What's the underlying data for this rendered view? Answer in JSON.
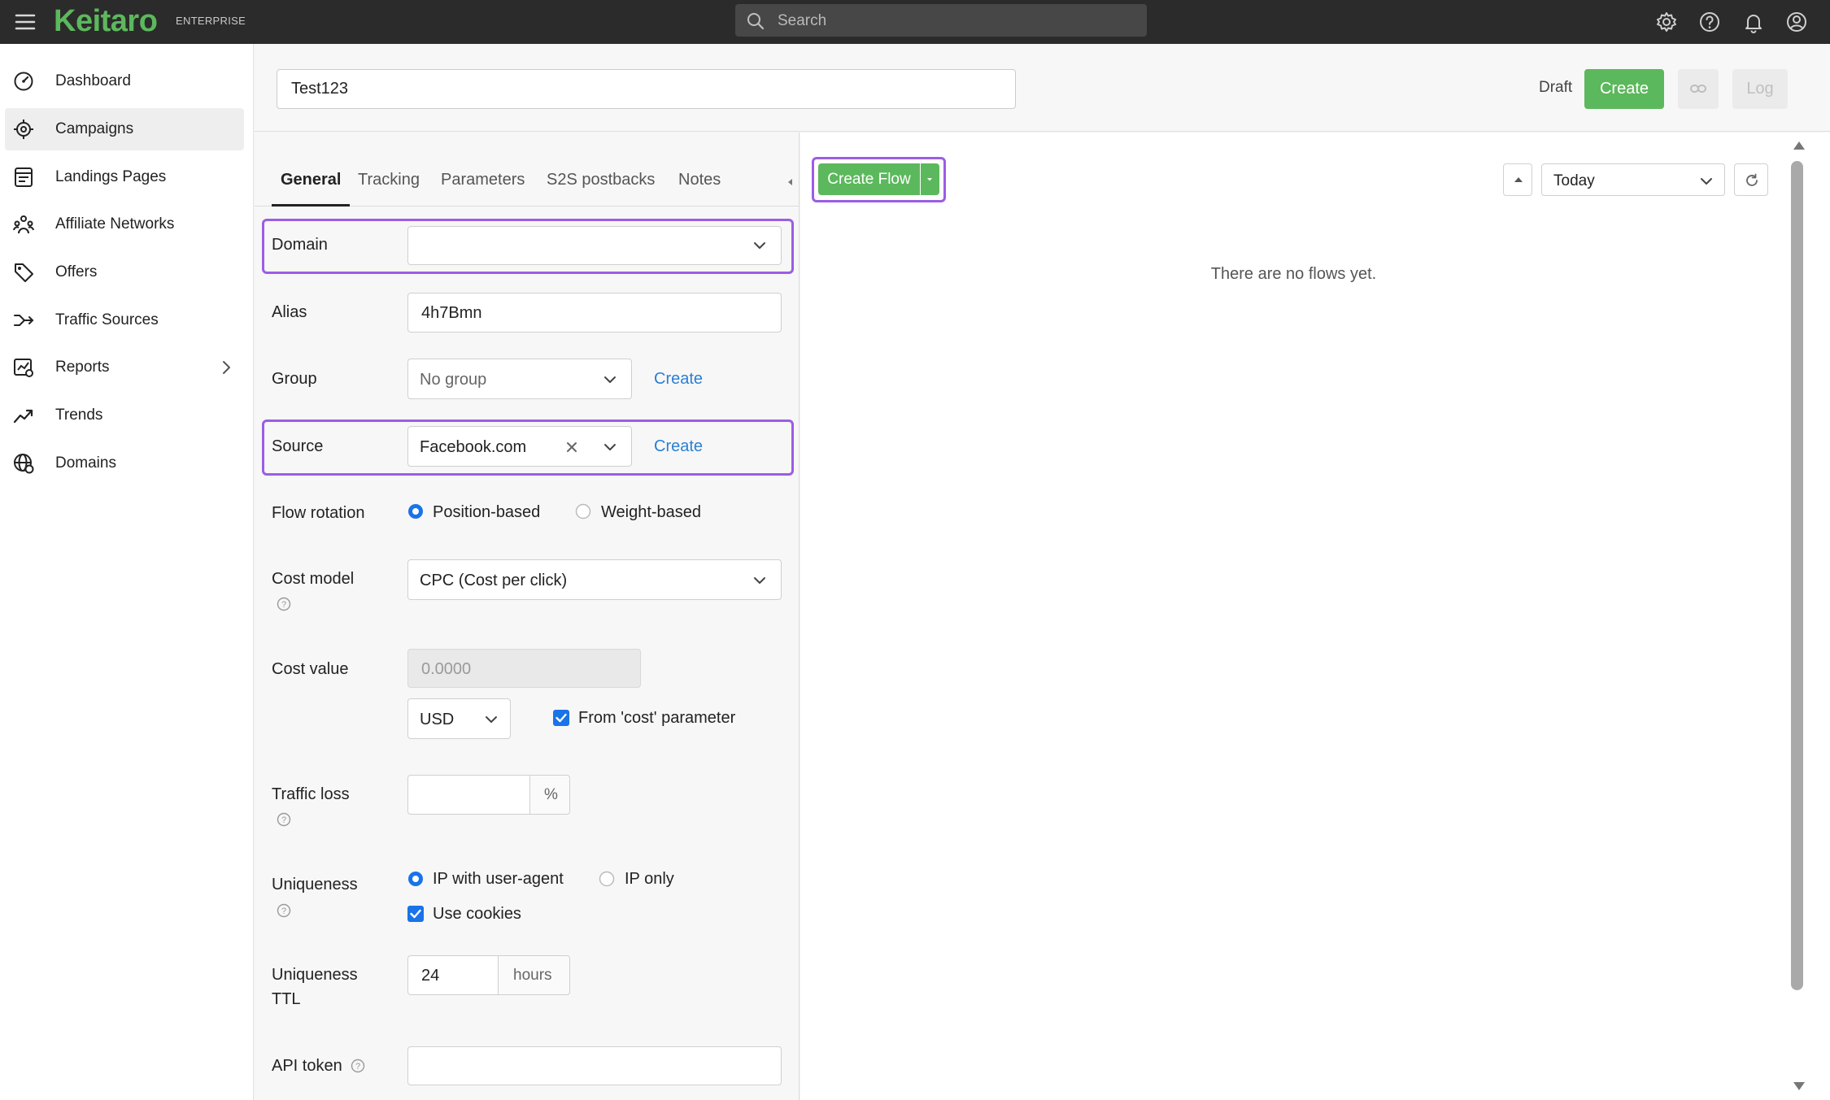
{
  "app": {
    "logo": "Keitaro",
    "edition": "ENTERPRISE",
    "search_placeholder": "Search"
  },
  "sidebar": {
    "items": [
      {
        "label": "Dashboard",
        "icon": "gauge-icon"
      },
      {
        "label": "Campaigns",
        "icon": "target-icon",
        "active": true
      },
      {
        "label": "Landings Pages",
        "icon": "page-icon"
      },
      {
        "label": "Affiliate Networks",
        "icon": "users-icon"
      },
      {
        "label": "Offers",
        "icon": "tag-icon"
      },
      {
        "label": "Traffic Sources",
        "icon": "route-icon"
      },
      {
        "label": "Reports",
        "icon": "report-icon",
        "has_submenu": true
      },
      {
        "label": "Trends",
        "icon": "trend-icon"
      },
      {
        "label": "Domains",
        "icon": "globe-icon"
      }
    ]
  },
  "campaign": {
    "name": "Test123",
    "status": "Draft",
    "create_label": "Create",
    "log_label": "Log"
  },
  "tabs": [
    "General",
    "Tracking",
    "Parameters",
    "S2S postbacks",
    "Notes"
  ],
  "form": {
    "domain": {
      "label": "Domain",
      "value": ""
    },
    "alias": {
      "label": "Alias",
      "value": "4h7Bmn"
    },
    "group": {
      "label": "Group",
      "value": "No group",
      "create_label": "Create"
    },
    "source": {
      "label": "Source",
      "value": "Facebook.com",
      "create_label": "Create"
    },
    "flow_rotation": {
      "label": "Flow rotation",
      "options": [
        "Position-based",
        "Weight-based"
      ],
      "selected": "Position-based"
    },
    "cost_model": {
      "label": "Cost model",
      "value": "CPC (Cost per click)"
    },
    "cost_value": {
      "label": "Cost value",
      "placeholder": "0.0000",
      "currency": "USD",
      "from_param_label": "From 'cost' parameter",
      "from_param_checked": true
    },
    "traffic_loss": {
      "label": "Traffic loss",
      "value": "",
      "unit": "%"
    },
    "uniqueness": {
      "label": "Uniqueness",
      "options": [
        "IP with user-agent",
        "IP only"
      ],
      "selected": "IP with user-agent",
      "use_cookies_label": "Use cookies",
      "use_cookies_checked": true
    },
    "uniqueness_ttl": {
      "label_line1": "Uniqueness",
      "label_line2": "TTL",
      "value": "24",
      "unit": "hours"
    },
    "api_token": {
      "label": "API token",
      "value": ""
    }
  },
  "flows": {
    "create_flow_label": "Create Flow",
    "period": "Today",
    "empty_message": "There are no flows yet."
  },
  "colors": {
    "topbar": "#2b2b2b",
    "brand_green": "#5cb85c",
    "highlight": "#9b5de5",
    "link": "#2a7fd4",
    "checkbox": "#1a73e8"
  }
}
